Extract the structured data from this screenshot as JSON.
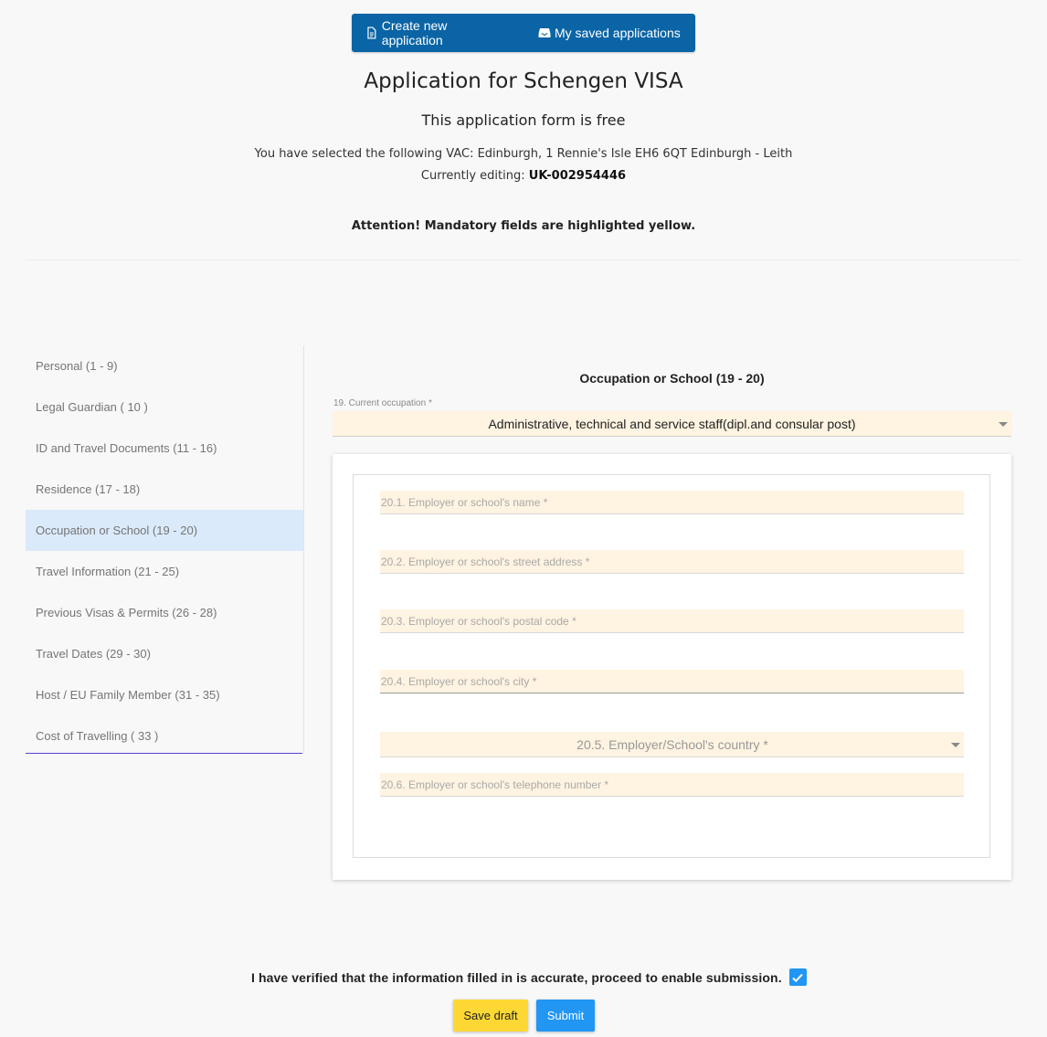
{
  "header": {
    "create_btn": "Create new application",
    "saved_btn": "My saved applications",
    "title": "Application for Schengen VISA",
    "subtitle": "This application form is free",
    "vac_text": "You have selected the following VAC: Edinburgh, 1 Rennie's Isle EH6 6QT Edinburgh - Leith",
    "editing_label": "Currently editing:",
    "editing_id": "UK-002954446",
    "attention": "Attention! Mandatory fields are highlighted yellow."
  },
  "sidebar": {
    "items": [
      {
        "label": "Personal (1 - 9)"
      },
      {
        "label": "Legal Guardian ( 10 )"
      },
      {
        "label": "ID and Travel Documents (11 - 16)"
      },
      {
        "label": "Residence (17 - 18)"
      },
      {
        "label": "Occupation or School (19 - 20)"
      },
      {
        "label": "Travel Information (21 - 25)"
      },
      {
        "label": "Previous Visas & Permits (26 - 28)"
      },
      {
        "label": "Travel Dates (29 - 30)"
      },
      {
        "label": "Host / EU Family Member (31 - 35)"
      },
      {
        "label": "Cost of Travelling ( 33 )"
      }
    ],
    "active": "Occupation or School (19 - 20)"
  },
  "section": {
    "title": "Occupation or School (19 - 20)",
    "occupation_label": "19. Current occupation *",
    "occupation_value": "Administrative, technical and service staff(dipl.and consular post)",
    "fields": {
      "employer_name": "20.1. Employer or school's name *",
      "street_address": "20.2. Employer or school's street address *",
      "postal_code": "20.3. Employer or school's postal code *",
      "city": "20.4. Employer or school's city *",
      "country": "20.5. Employer/School's country *",
      "telephone": "20.6. Employer or school's telephone number *"
    }
  },
  "footer": {
    "verify_text": "I have verified that the information filled in is accurate, proceed to enable submission.",
    "verify_checked": true,
    "save_label": "Save draft",
    "submit_label": "Submit"
  },
  "colors": {
    "primary": "#0a64a6",
    "mandatory_bg": "#fff3e1",
    "active_nav": "#dbeafa",
    "save": "#fdd835",
    "submit": "#2196f3"
  }
}
